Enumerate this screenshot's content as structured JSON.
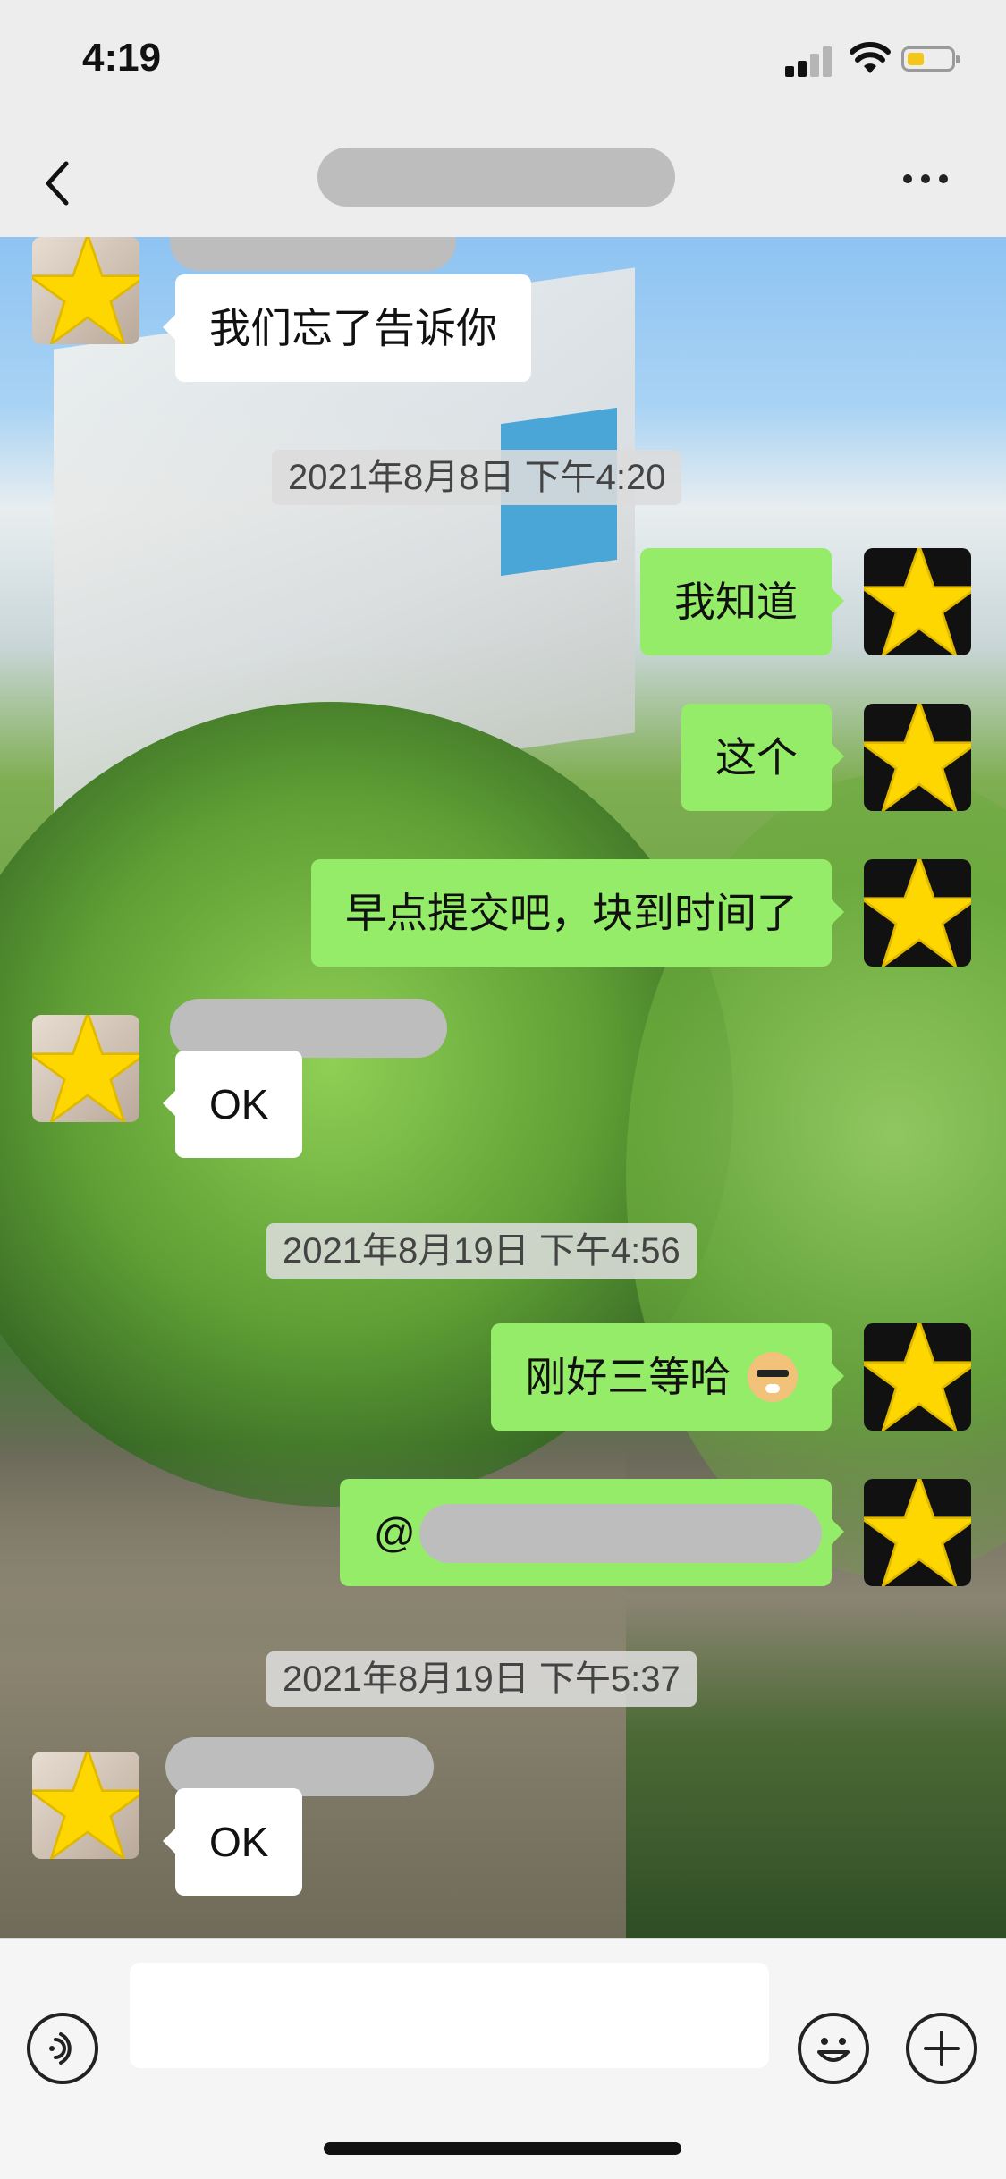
{
  "status_bar": {
    "time": "4:19"
  },
  "nav": {
    "title": ""
  },
  "messages": [
    {
      "side": "left",
      "text": "我们忘了告诉你"
    },
    {
      "side": "right",
      "text": "我知道"
    },
    {
      "side": "right",
      "text": "这个"
    },
    {
      "side": "right",
      "text": "早点提交吧，块到时间了"
    },
    {
      "side": "left",
      "text": "OK"
    },
    {
      "side": "right",
      "text": "刚好三等哈"
    },
    {
      "side": "right",
      "text": "@"
    },
    {
      "side": "left",
      "text": "OK"
    }
  ],
  "timestamps": [
    "2021年8月8日 下午4:20",
    "2021年8月19日 下午4:56",
    "2021年8月19日 下午5:37"
  ],
  "input": {
    "placeholder": ""
  },
  "colors": {
    "bubble_sent": "#95ec69",
    "bubble_received": "#ffffff",
    "avatar_star": "#ffd700",
    "nav_background": "#ededed"
  }
}
